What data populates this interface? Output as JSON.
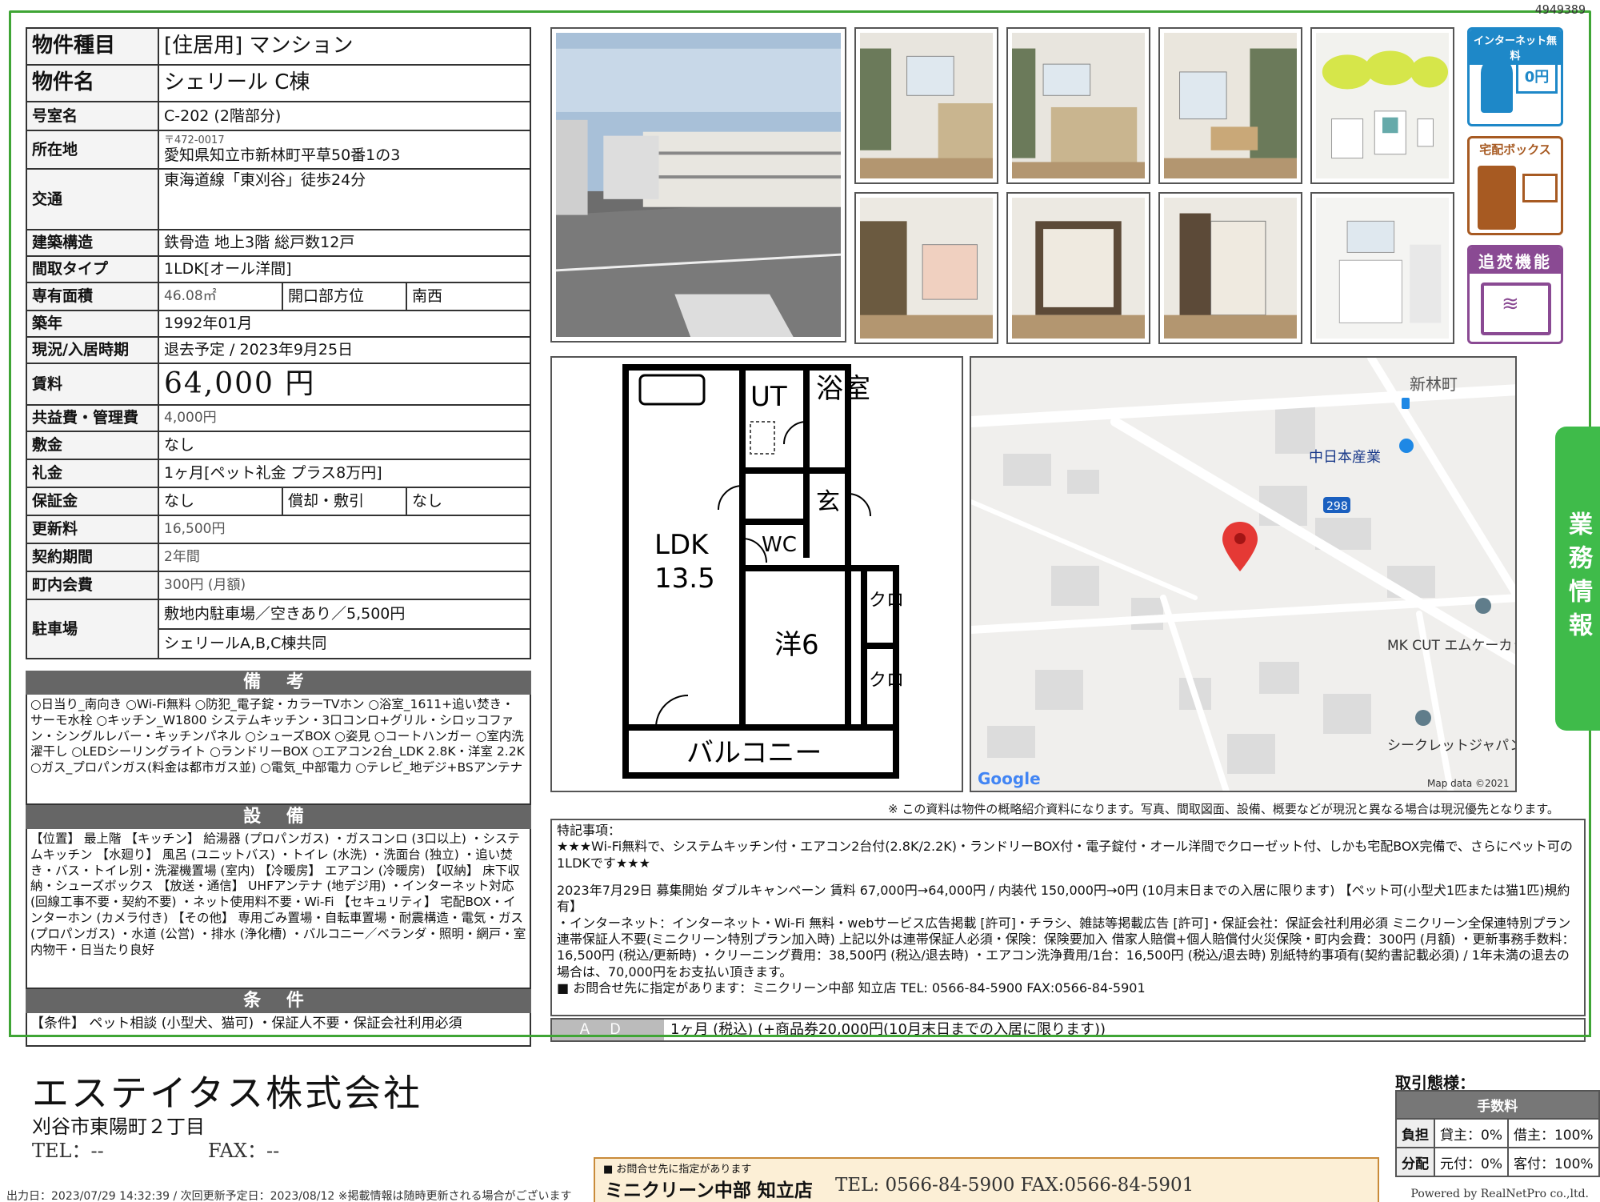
{
  "property_id": "4949389",
  "spec": {
    "type": {
      "label": "物件種目",
      "value": "[住居用] マンション"
    },
    "name": {
      "label": "物件名",
      "value": "シェリール C棟"
    },
    "room": {
      "label": "号室名",
      "value": "C-202 (2階部分)"
    },
    "address": {
      "label": "所在地",
      "zip": "〒472-0017",
      "value": "愛知県知立市新林町平草50番1の3"
    },
    "access": {
      "label": "交通",
      "value": "東海道線「東刈谷」徒歩24分"
    },
    "structure": {
      "label": "建築構造",
      "value": "鉄骨造 地上3階 総戸数12戸"
    },
    "layout": {
      "label": "間取タイプ",
      "value": "1LDK[オール洋間]"
    },
    "area": {
      "label": "専有面積",
      "value": "46.08㎡",
      "label2": "開口部方位",
      "value2": "南西"
    },
    "built": {
      "label": "築年",
      "value": "1992年01月"
    },
    "status": {
      "label": "現況/入居時期",
      "value": "退去予定 / 2023年9月25日"
    },
    "rent": {
      "label": "賃料",
      "value": "64,000 円"
    },
    "mgmt": {
      "label": "共益費・管理費",
      "value": "4,000円"
    },
    "deposit": {
      "label": "敷金",
      "value": "なし"
    },
    "key_money": {
      "label": "礼金",
      "value": "1ヶ月[ペット礼金 プラス8万円]"
    },
    "guarantee": {
      "label": "保証金",
      "value": "なし",
      "label2": "償却・敷引",
      "value2": "なし"
    },
    "renewal": {
      "label": "更新料",
      "value": "16,500円"
    },
    "contract": {
      "label": "契約期間",
      "value": "2年間"
    },
    "town_fee": {
      "label": "町内会費",
      "value": "300円 (月額)"
    },
    "parking": {
      "label": "駐車場",
      "value": "敷地内駐車場／空きあり／5,500円",
      "value2": "シェリールA,B,C棟共同"
    }
  },
  "remarks": {
    "title": "備 考",
    "text": "○日当り_南向き ○Wi-Fi無料 ○防犯_電子錠・カラーTVホン ○浴室_1611+追い焚き・サーモ水栓 ○キッチン_W1800 システムキッチン・3口コンロ+グリル・シロッコファン・シングルレバー・キッチンパネル ○シューズBOX ○姿見 ○コートハンガー ○室内洗濯干し ○LEDシーリングライト ○ランドリーBOX ○エアコン2台_LDK 2.8K・洋室 2.2K ○ガス_プロパンガス(料金は都市ガス並) ○電気_中部電力 ○テレビ_地デジ+BSアンテナ"
  },
  "equipment": {
    "title": "設 備",
    "text": "【位置】 最上階 【キッチン】 給湯器 (プロパンガス) ・ガスコンロ (3口以上) ・システムキッチン 【水廻り】 風呂 (ユニットバス) ・トイレ (水洗) ・洗面台 (独立) ・追い焚き・バス・トイレ別・洗濯機置場 (室内) 【冷暖房】 エアコン (冷暖房) 【収納】 床下収納・シューズボックス 【放送・通信】 UHFアンテナ (地デジ用) ・インターネット対応 (回線工事不要・契約不要) ・ネット使用料不要・Wi-Fi 【セキュリティ】 宅配BOX・インターホン (カメラ付き) 【その他】 専用ごみ置場・自転車置場・耐震構造・電気・ガス (プロパンガス) ・水道 (公営) ・排水 (浄化槽) ・バルコニー／ベランダ・照明・網戸・室内物干・日当たり良好"
  },
  "conditions": {
    "title": "条 件",
    "text": "【条件】 ペット相談 (小型犬、猫可) ・保証人不要・保証会社利用必須"
  },
  "badges": {
    "internet": "インターネット無料",
    "internet_sub": "0円",
    "delivery": "宅配ボックス",
    "reheat": "追焚機能"
  },
  "side_tab": "業務情報",
  "floorplan": {
    "ut": "UT",
    "bath": "浴室",
    "entrance": "玄",
    "wc": "WC",
    "ldk": "LDK",
    "ldk_size": "13.5",
    "western": "洋6",
    "closet1": "クロ",
    "closet2": "クロ",
    "balcony": "バルコニー"
  },
  "map": {
    "place1": "新林町",
    "place2": "中日本産業",
    "road": "298",
    "place3": "MK CUT エムケーカット 知立",
    "place4": "シークレットジャパンしゅん",
    "google": "Google",
    "mapdata": "Map data ©2021"
  },
  "disclaimer": "※ この資料は物件の概略紹介資料になります。写真、間取図面、設備、概要などが現況と異なる場合は現況優先となります。",
  "notes": {
    "heading": "特記事項：",
    "p1": "★★★Wi-Fi無料で、システムキッチン付・エアコン2台付(2.8K/2.2K)・ランドリーBOX付・電子錠付・オール洋間でクローゼット付、しかも宅配BOX完備で、さらにペット可の1LDKです★★★",
    "p2": "2023年7月29日 募集開始 ダブルキャンペーン 賃料 67,000円→64,000円 / 内装代 150,000円→0円 (10月末日までの入居に限ります) 【ペット可(小型犬1匹または猫1匹)規約有】",
    "p3": "・インターネット：インターネット・Wi-Fi 無料・webサービス広告掲載 [許可]・チラシ、雑誌等掲載広告 [許可]・保証会社：保証会社利用必須 ミニクリーン全保連特別プラン 連帯保証人不要(ミニクリーン特別プラン加入時) 上記以外は連帯保証人必須・保険：保険要加入 借家人賠償+個人賠償付火災保険・町内会費：300円 (月額) ・更新事務手数料：16,500円 (税込/更新時) ・クリーニング費用：38,500円 (税込/退去時) ・エアコン洗浄費用/1台：16,500円 (税込/退去時) 別紙特約事項有(契約書記載必須) / 1年未満の退去の場合は、70,000円をお支払い頂きます。",
    "p4": "■ お問合せ先に指定があります：ミニクリーン中部 知立店 TEL: 0566-84-5900 FAX:0566-84-5901"
  },
  "ad": {
    "label": "ＡＤ",
    "value": "1ヶ月 (税込) (+商品券20,000円(10月末日までの入居に限ります))"
  },
  "company": {
    "name": "エステイタス株式会社",
    "address": "刈谷市東陽町２丁目",
    "tel": "TEL：--",
    "fax": "FAX：--"
  },
  "fee_table": {
    "title": "取引態様：",
    "head": "手数料",
    "row1_label": "負担",
    "row1_a": "貸主：0%",
    "row1_b": "借主：100%",
    "row2_label": "分配",
    "row2_a": "元付：0%",
    "row2_b": "客付：100%"
  },
  "inquiry": {
    "line1": "■ お問合せ先に指定があります",
    "name": "ミニクリーン中部 知立店",
    "tel": "TEL: 0566-84-5900 FAX:0566-84-5901"
  },
  "footer": {
    "out_date": "出力日：2023/07/29 14:32:39 / 次回更新予定日：2023/08/12 ※掲載情報は随時更新される場合がございます",
    "powered": "Powered by RealNetPro co.,ltd."
  },
  "colors": {
    "accent_green": "#3fa535",
    "badge_purple": "#8a4a93",
    "badge_blue": "#1e88c8",
    "header_gray": "#666666"
  }
}
